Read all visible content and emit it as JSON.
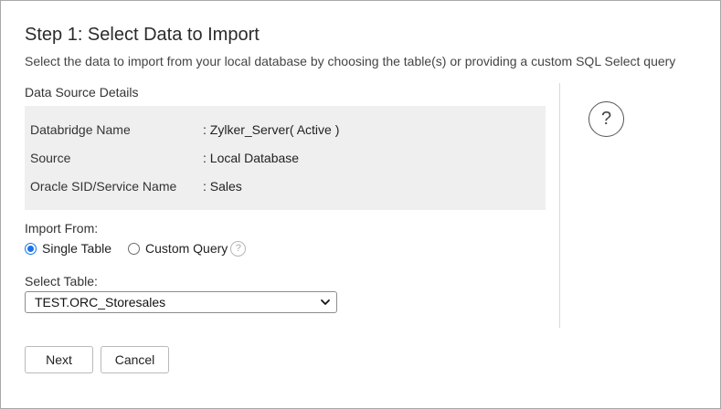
{
  "header": {
    "title": "Step 1: Select Data to Import",
    "subtitle": "Select the data to import from your local database by choosing the table(s) or providing a custom SQL Select query"
  },
  "data_source": {
    "section_label": "Data Source Details",
    "rows": [
      {
        "label": "Databridge Name",
        "value": ": Zylker_Server( Active )"
      },
      {
        "label": "Source",
        "value": ": Local Database"
      },
      {
        "label": "Oracle SID/Service Name",
        "value": ": Sales"
      }
    ]
  },
  "import_from": {
    "label": "Import From:",
    "options": [
      {
        "label": "Single Table",
        "checked": true
      },
      {
        "label": "Custom Query",
        "checked": false
      }
    ],
    "help_icon": "question-circle-icon"
  },
  "select_table": {
    "label": "Select Table:",
    "value": "TEST.ORC_Storesales"
  },
  "help": {
    "glyph": "?",
    "small_glyph": "?"
  },
  "buttons": {
    "next": "Next",
    "cancel": "Cancel"
  },
  "colors": {
    "accent": "#1a73e8",
    "panel_bg": "#efefef"
  }
}
